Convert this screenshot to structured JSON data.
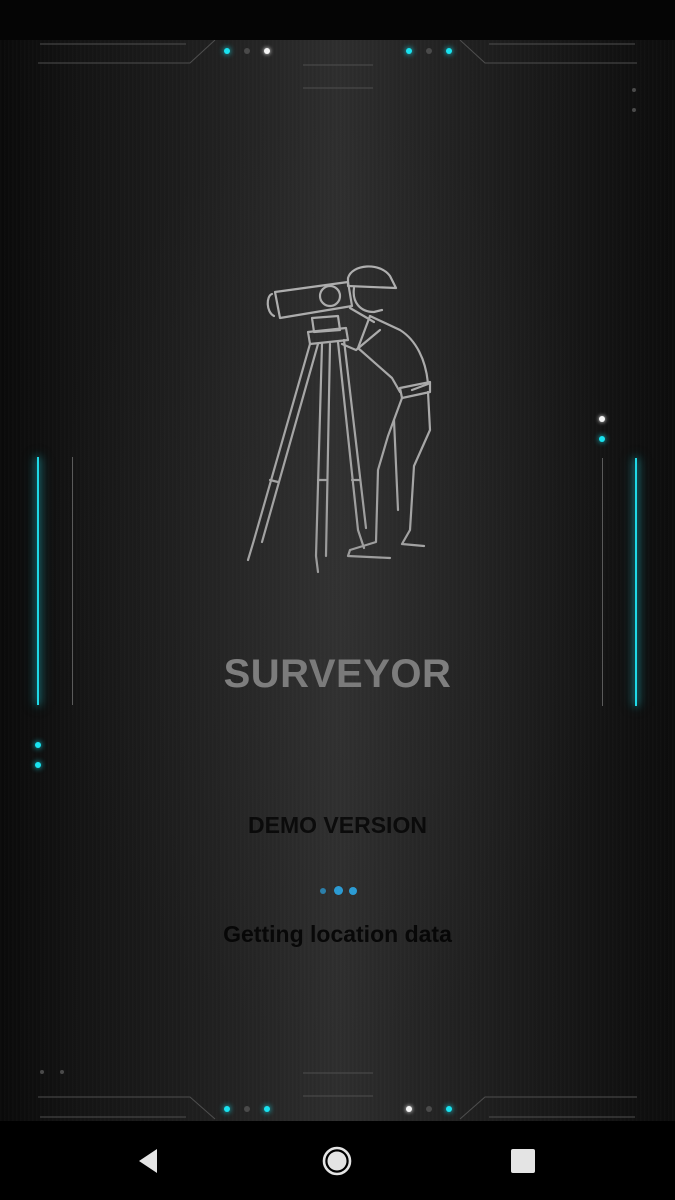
{
  "app": {
    "title": "SURVEYOR",
    "version_label": "DEMO VERSION",
    "status_text": "Getting location data"
  },
  "illustration": {
    "icon": "surveyor-with-theodolite-icon"
  },
  "loading_indicator": {
    "icon": "loading-dots-icon",
    "dot_count": 3
  },
  "navigation_bar": {
    "back": {
      "icon": "back-triangle-icon"
    },
    "home": {
      "icon": "home-circle-icon"
    },
    "recents": {
      "icon": "recents-square-icon"
    }
  },
  "colors": {
    "accent_cyan": "#19e3f0",
    "title_gray": "#8a8a8a",
    "text_dark": "#050505",
    "loading_blue": "#2aa3e0",
    "background_dark": "#1c1c1c"
  }
}
